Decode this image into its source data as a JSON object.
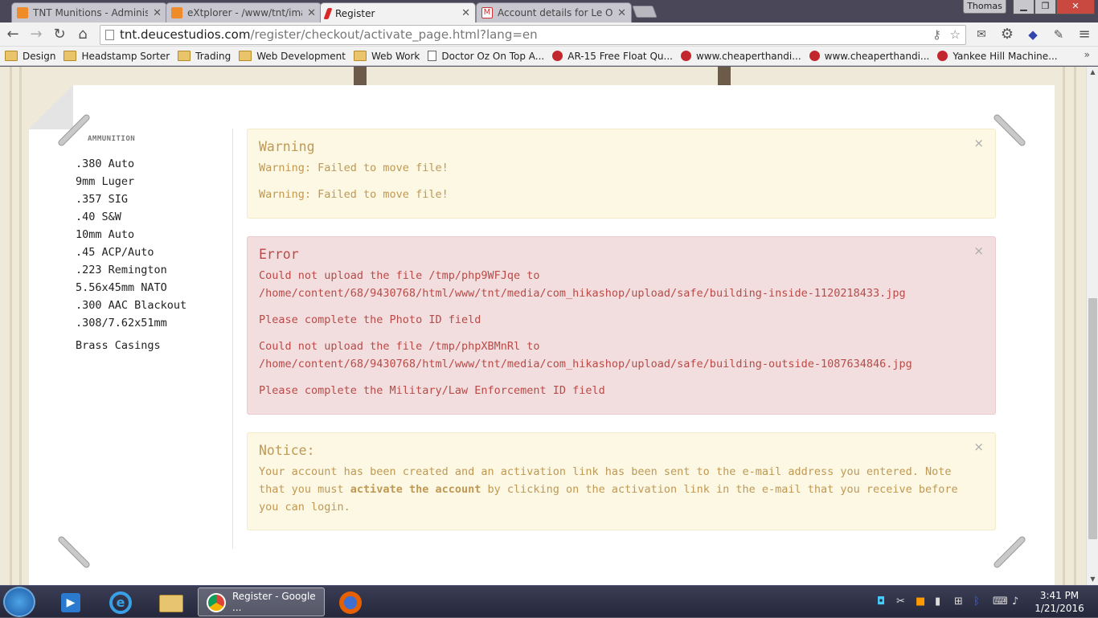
{
  "browser": {
    "tabs": [
      {
        "title": "TNT Munitions - Administr",
        "active": false,
        "favicon": "joomla-icon"
      },
      {
        "title": "eXtplorer - /www/tnt/imag",
        "active": false,
        "favicon": "joomla-icon"
      },
      {
        "title": "Register",
        "active": true,
        "favicon": "tnt-icon"
      },
      {
        "title": "Account details for Le One",
        "active": false,
        "favicon": "gmail-icon"
      }
    ],
    "user": "Thomas",
    "address": {
      "host": "tnt.deucestudios.com",
      "path": "/register/checkout/activate_page.html?lang=en"
    },
    "bookmarks": [
      {
        "label": "Design",
        "icon": "folder-icon"
      },
      {
        "label": "Headstamp Sorter",
        "icon": "folder-icon"
      },
      {
        "label": "Trading",
        "icon": "folder-icon"
      },
      {
        "label": "Web Development",
        "icon": "folder-icon"
      },
      {
        "label": "Web Work",
        "icon": "folder-icon"
      },
      {
        "label": "Doctor Oz On Top A...",
        "icon": "page-icon"
      },
      {
        "label": "AR-15 Free Float Qu...",
        "icon": "gun-site-icon"
      },
      {
        "label": "www.cheaperthandi...",
        "icon": "gun-site-icon"
      },
      {
        "label": "www.cheaperthandi...",
        "icon": "gun-site-icon"
      },
      {
        "label": "Yankee Hill Machine...",
        "icon": "gun-site-icon"
      }
    ]
  },
  "sidebar": {
    "heading": "AMMUNITION",
    "items": [
      ".380 Auto",
      "9mm Luger",
      ".357 SIG",
      ".40 S&W",
      "10mm Auto",
      ".45 ACP/Auto",
      ".223 Remington",
      "5.56x45mm NATO",
      ".300 AAC Blackout",
      ".308/7.62x51mm"
    ],
    "extra": "Brass Casings"
  },
  "alerts": {
    "warning": {
      "heading": "Warning",
      "lines": [
        "Warning: Failed to move file!",
        "Warning: Failed to move file!"
      ]
    },
    "error": {
      "heading": "Error",
      "l1a": "Could not upload the file /tmp/php9WFJqe to",
      "l1b": "/home/content/68/9430768/html/www/tnt/media/com_hikashop/upload/safe/building-inside-1120218433.jpg",
      "l2": "Please complete the Photo ID field",
      "l3a": "Could not upload the file /tmp/phpXBMnRl to",
      "l3b": "/home/content/68/9430768/html/www/tnt/media/com_hikashop/upload/safe/building-outside-1087634846.jpg",
      "l4": "Please complete the Military/Law Enforcement ID field"
    },
    "notice": {
      "heading": "Notice:",
      "text_before": "Your account has been created and an activation link has been sent to the e-mail address you entered. Note that you must ",
      "bold": "activate the account",
      "text_after": " by clicking on the activation link in the e-mail that you receive before you can login."
    },
    "close_glyph": "×"
  },
  "taskbar": {
    "active_window": "Register - Google ...",
    "time": "3:41 PM",
    "date": "1/21/2016"
  },
  "colors": {
    "warning_text": "#c09853",
    "error_text": "#b94a48",
    "warning_bg": "#fcf8e3",
    "error_bg": "#f2dede"
  }
}
